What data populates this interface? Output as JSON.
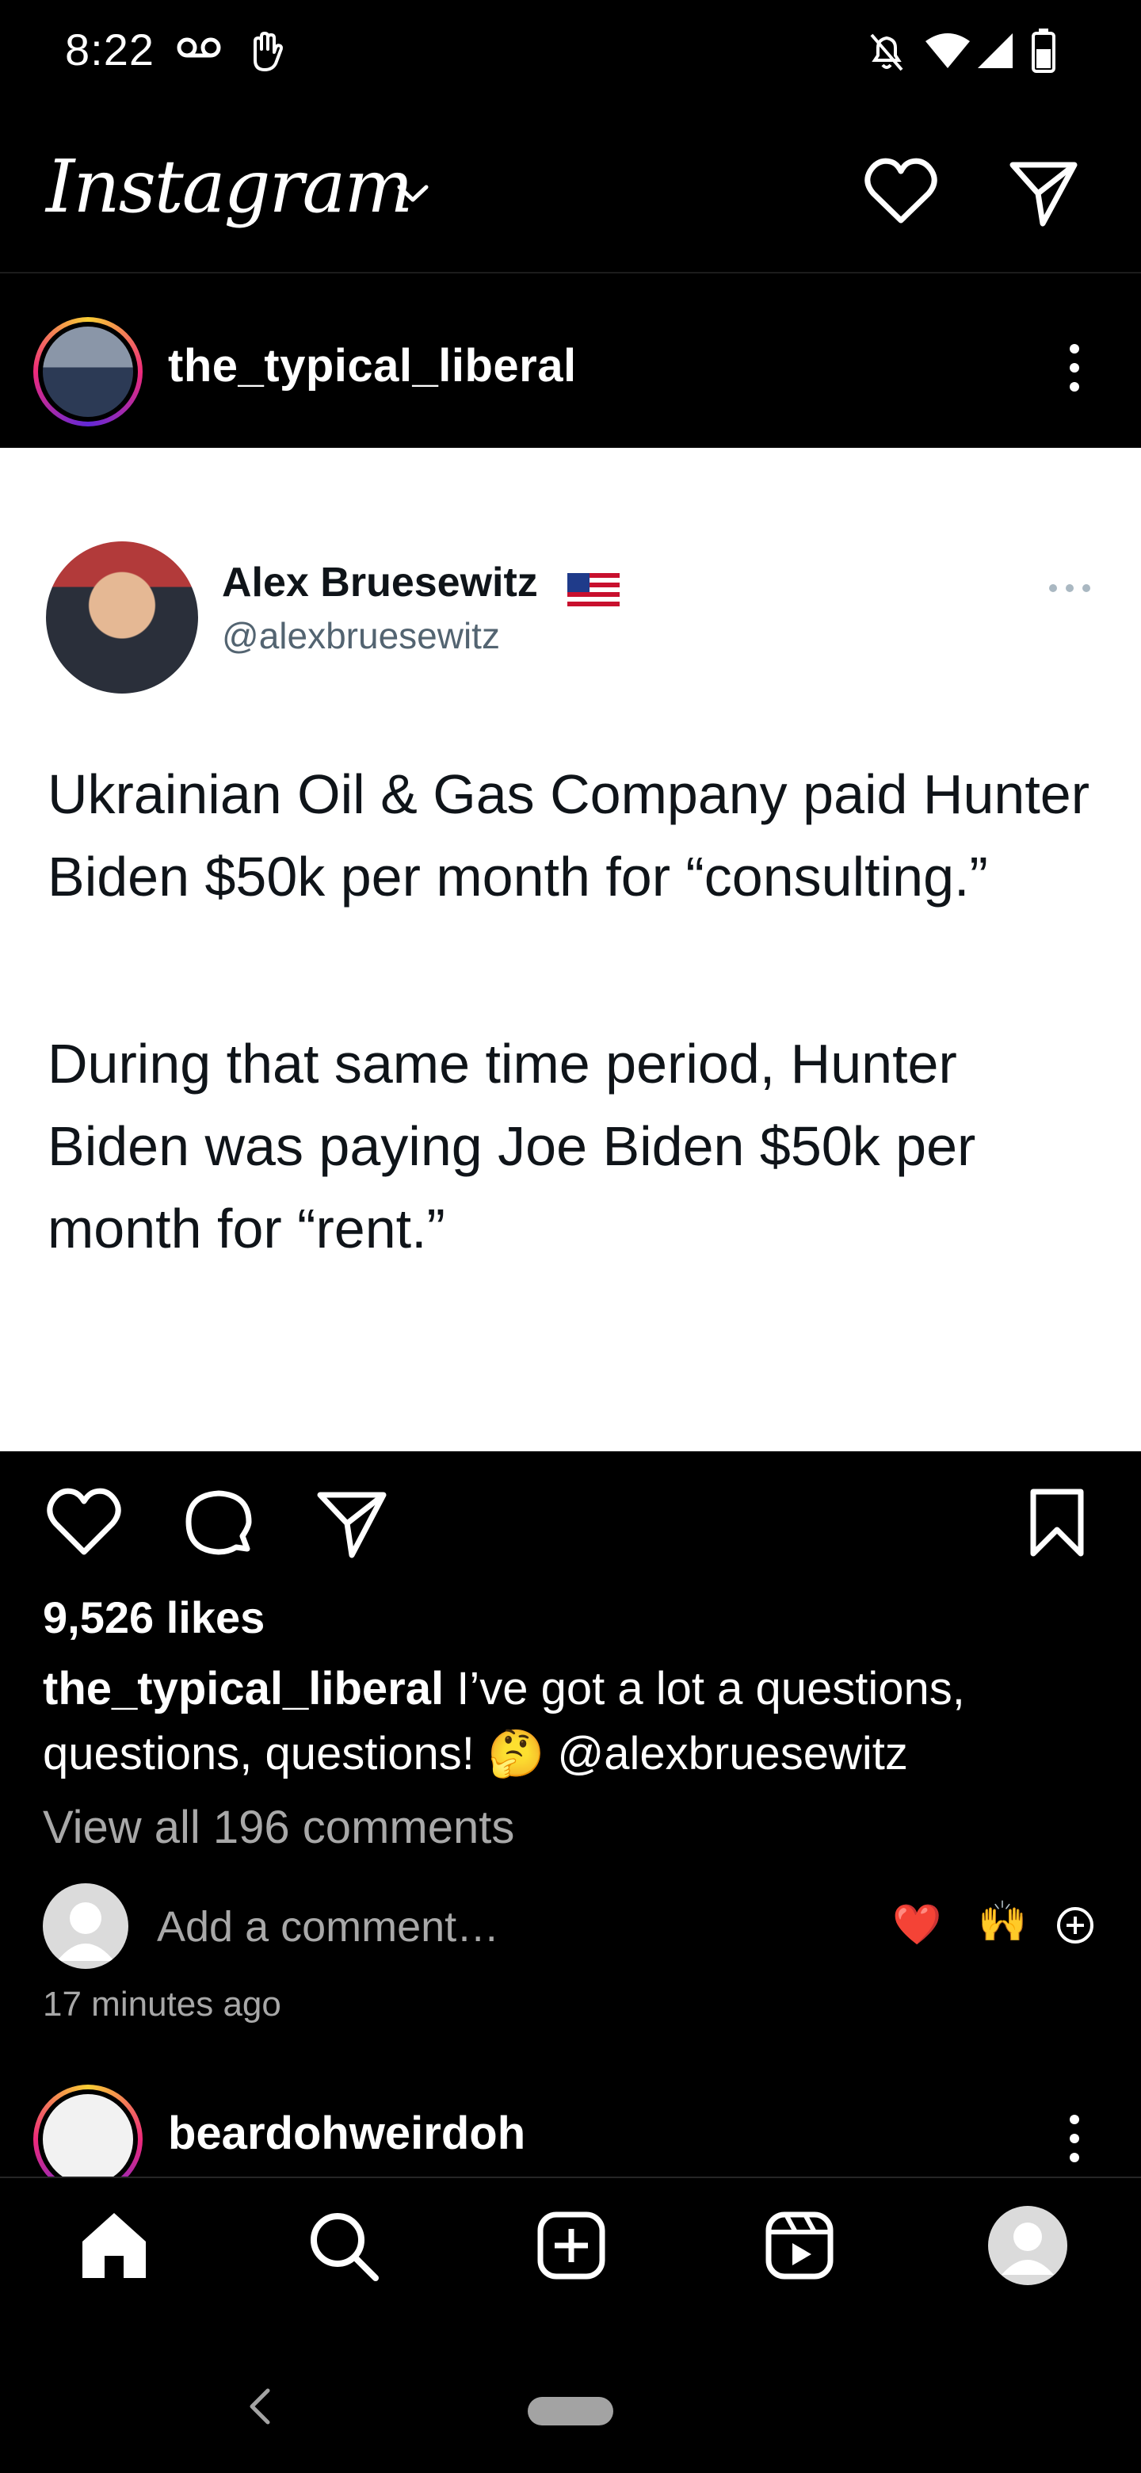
{
  "status_bar": {
    "time": "8:22",
    "icons": [
      "voicemail-icon",
      "hand-wave-icon",
      "notifications-muted-icon",
      "wifi-icon",
      "signal-icon",
      "battery-icon"
    ]
  },
  "app_bar": {
    "logo": "Instagram",
    "icons": [
      "chevron-down-icon",
      "heart-icon",
      "direct-message-icon"
    ]
  },
  "post": {
    "username": "the_typical_liberal",
    "tweet": {
      "author_name": "Alex Bruesewitz",
      "author_handle": "@alexbruesewitz",
      "paragraph_1": "Ukrainian Oil & Gas Company paid Hunter Biden $50k per month for “consulting.”",
      "paragraph_2": "During that same time period, Hunter Biden was paying Joe Biden $50k per month for “rent.”"
    },
    "likes": "9,526 likes",
    "caption_user": "the_typical_liberal",
    "caption_text": " I’ve got a lot a questions, questions, questions! 🤔 @alexbruesewitz",
    "view_all_comments": "View all 196 comments",
    "comment_placeholder": "Add a comment…",
    "time_ago": "17 minutes ago",
    "quick_reactions": [
      "❤️",
      "🙌"
    ]
  },
  "next_post": {
    "username": "beardohweirdoh"
  },
  "bottom_nav": {
    "items": [
      "home-icon",
      "search-icon",
      "create-icon",
      "reels-icon",
      "profile-icon"
    ]
  },
  "colors": {
    "background": "#000000",
    "text": "#ffffff",
    "secondary_text": "#a8a8a8",
    "tweet_text": "#0f1419",
    "tweet_handle": "#536471"
  }
}
